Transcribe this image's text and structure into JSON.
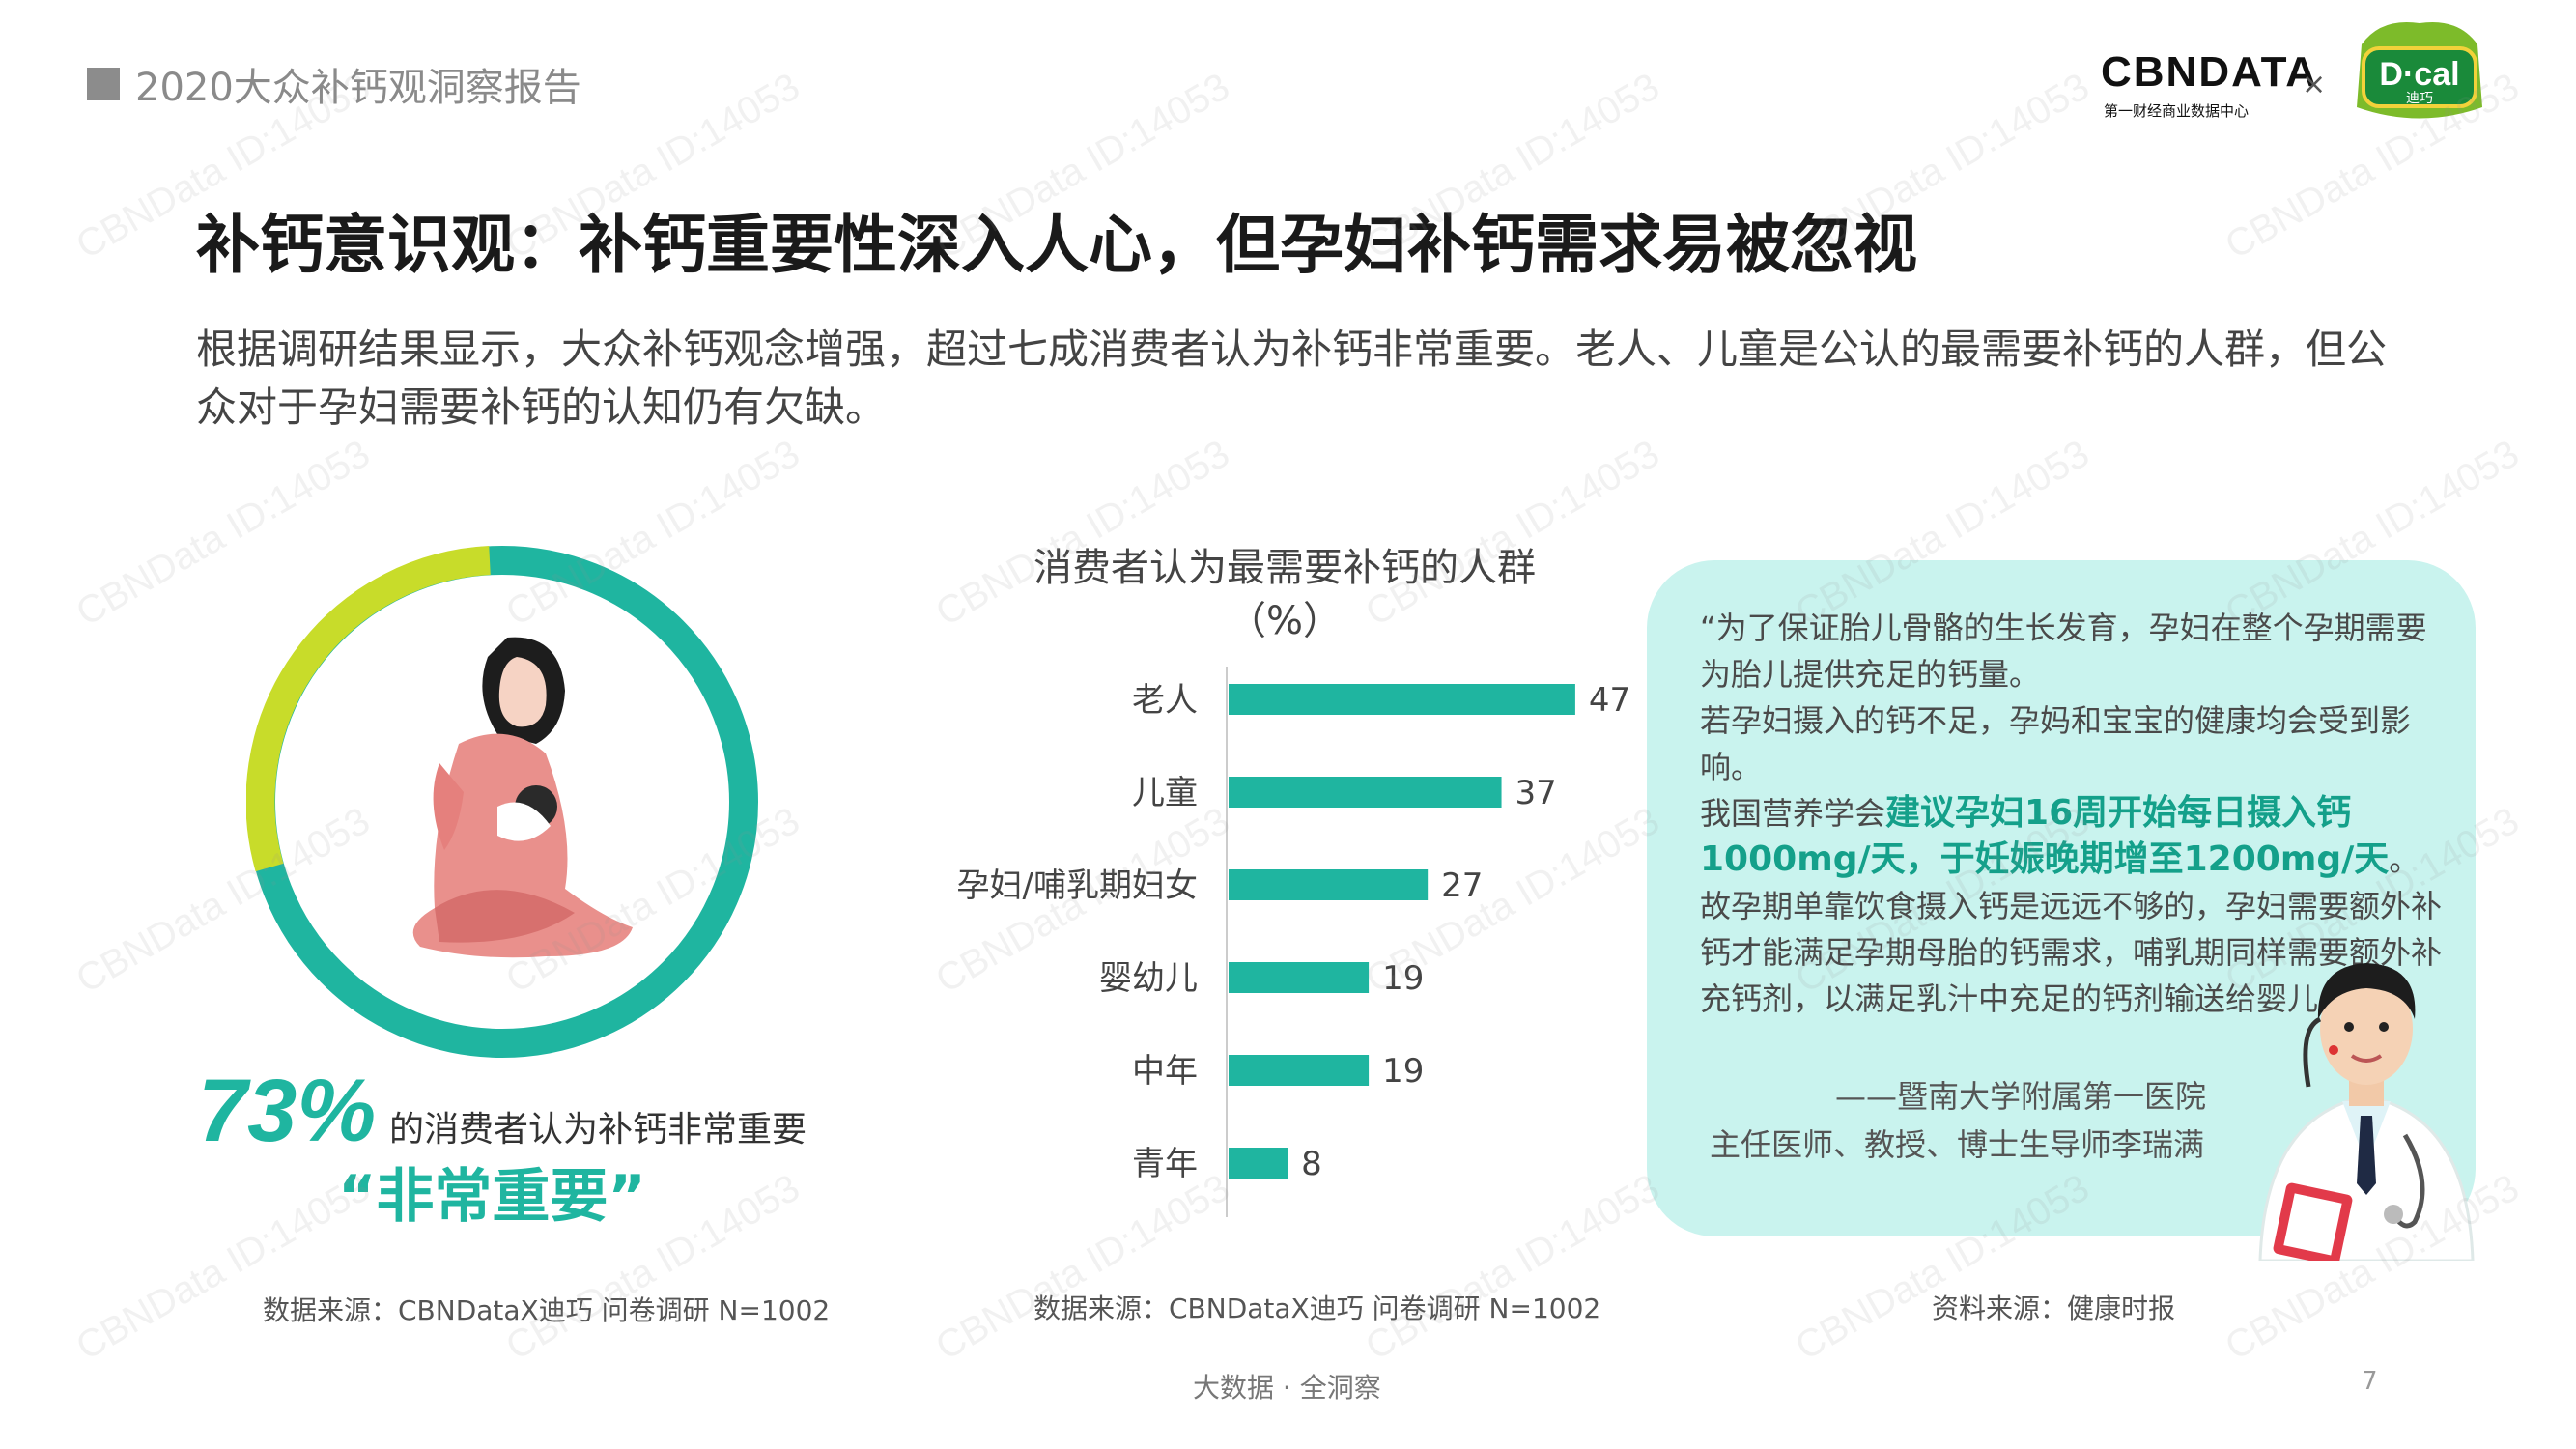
{
  "header": {
    "report_title": "2020大众补钙观洞察报告",
    "brand_cbn": "CBNDATA",
    "brand_cbn_sub": "第一财经商业数据中心",
    "brand_sep": "×",
    "brand_dcal": "D·cal",
    "brand_dcal_sub": "迪巧"
  },
  "headline": "补钙意识观：补钙重要性深入人心，但孕妇补钙需求易被忽视",
  "intro": "根据调研结果显示，大众补钙观念增强，超过七成消费者认为补钙非常重要。老人、儿童是公认的最需要补钙的人群，但公众对于孕妇需要补钙的认知仍有欠缺。",
  "left": {
    "percent": "73%",
    "percent_value": 73,
    "percent_text": "的消费者认为补钙非常重要",
    "quote": "“非常重要”",
    "source": "数据来源：CBNDataX迪巧 问卷调研 N=1002"
  },
  "chart_data": {
    "type": "bar",
    "orientation": "horizontal",
    "title": "消费者认为最需要补钙的人群",
    "unit": "（%）",
    "categories": [
      "老人",
      "儿童",
      "孕妇/哺乳期妇女",
      "婴幼儿",
      "中年",
      "青年"
    ],
    "values": [
      47,
      37,
      27,
      19,
      19,
      8
    ],
    "xlim": [
      0,
      55
    ],
    "bar_color": "#1fb5a0",
    "grid": false,
    "source": "数据来源：CBNDataX迪巧 问卷调研 N=1002"
  },
  "quote_box": {
    "line1": "“为了保证胎儿骨骼的生长发育，孕妇在整个孕期需要为胎儿提供充足的钙量。",
    "line2": "若孕妇摄入的钙不足，孕妈和宝宝的健康均会受到影响。",
    "line3_pre": "我国营养学会",
    "line3_hl": "建议孕妇16周开始每日摄入钙1000mg/天，于妊娠晚期增至1200mg/天",
    "line3_post": "。",
    "line4": "故孕期单靠饮食摄入钙是远远不够的，孕妇需要额外补钙才能满足孕期母胎的钙需求，哺乳期同样需要额外补充钙剂，以满足乳汁中充足的钙剂输送给婴儿。”",
    "author_line1": "——暨南大学附属第一医院",
    "author_line2": "主任医师、教授、博士生导师李瑞满",
    "source": "资料来源：健康时报"
  },
  "footer": {
    "slogan": "大数据 · 全洞察",
    "page": "7"
  },
  "watermark": "CBNData ID:14053",
  "colors": {
    "accent": "#1fb5a0",
    "ring_secondary": "#c8dc2a",
    "quote_bg": "#c9f3ee"
  }
}
